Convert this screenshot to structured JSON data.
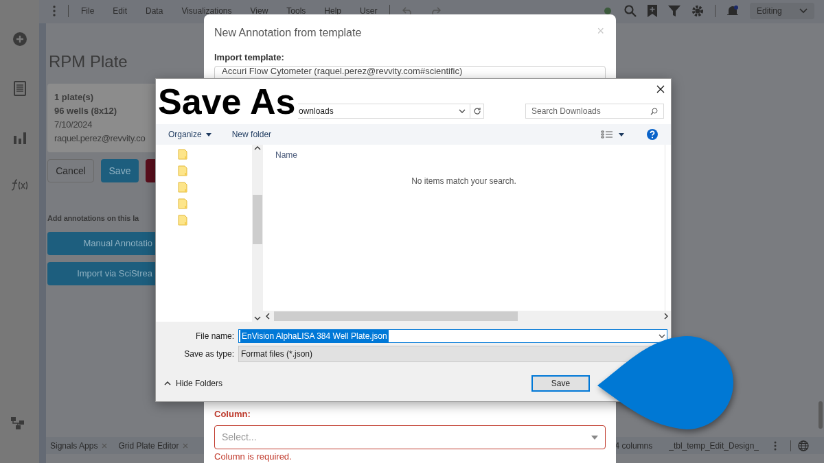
{
  "menu": [
    "File",
    "Edit",
    "Data",
    "Visualizations",
    "View",
    "Tools",
    "Help",
    "User"
  ],
  "mode": "Editing",
  "page": {
    "title": "RPM Plate",
    "info": [
      "1 plate(s)",
      "96 wells (8x12)",
      "7/10/2024",
      "raquel.perez@revvity.co"
    ],
    "cancel": "Cancel",
    "save": "Save",
    "annotations_heading": "Add annotations on this la",
    "actions": [
      "Manual Annotatio",
      "Import via SciStrea"
    ]
  },
  "bottom_tabs": [
    {
      "label": "Signals Apps",
      "closable": true
    },
    {
      "label": "Grid Plate Editor",
      "closable": true
    }
  ],
  "bottom_tabs_right": [
    "4 columns",
    "_tbl_temp_Edit_Design_"
  ],
  "annotation_modal": {
    "title": "New Annotation from template",
    "close": "×",
    "import_label": "Import template:",
    "import_value": "Accuri Flow Cytometer (raquel.perez@revvity.com#scientific)",
    "column_label": "Column:",
    "column_placeholder": "Select...",
    "column_error": "Column is required."
  },
  "save_dialog": {
    "title": "Save As",
    "address": "ownloads",
    "search_placeholder": "Search Downloads",
    "toolbar": [
      "Organize",
      "New folder"
    ],
    "column_header": "Name",
    "empty_message": "No items match your search.",
    "file_name_label": "File name:",
    "file_name": "EnVision AlphaLISA 384 Well Plate.json",
    "type_label": "Save as type:",
    "type_value": "Format files (*.json)",
    "hide_folders": "Hide Folders",
    "save_button": "Save"
  }
}
